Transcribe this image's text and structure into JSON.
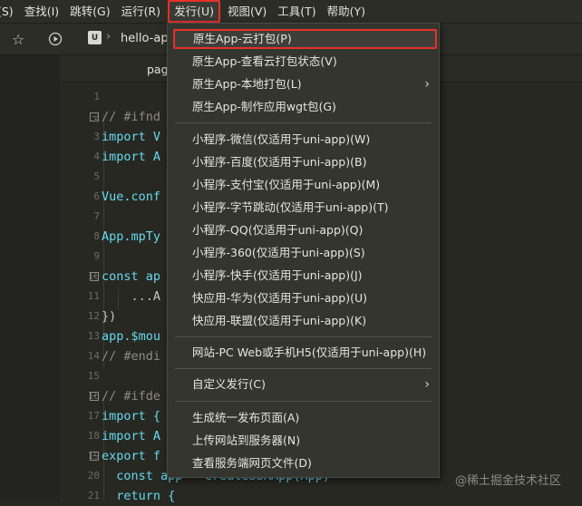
{
  "menubar": {
    "items": [
      "(S)",
      "查找(I)",
      "跳转(G)",
      "运行(R)",
      "发行(U)",
      "视图(V)",
      "工具(T)",
      "帮助(Y)"
    ]
  },
  "toolbar": {
    "breadcrumb": "hello-ap",
    "project_icon_letter": "U"
  },
  "editor": {
    "tab_label": "pages.json",
    "lines": [
      {
        "n": "1",
        "text": ""
      },
      {
        "n": "2",
        "text": "// #ifnd"
      },
      {
        "n": "3",
        "text": "import V"
      },
      {
        "n": "4",
        "text": "import A"
      },
      {
        "n": "5",
        "text": ""
      },
      {
        "n": "6",
        "text": "Vue.conf"
      },
      {
        "n": "7",
        "text": ""
      },
      {
        "n": "8",
        "text": "App.mpTy"
      },
      {
        "n": "9",
        "text": ""
      },
      {
        "n": "10",
        "text": "const ap"
      },
      {
        "n": "11",
        "text": "    ...A"
      },
      {
        "n": "12",
        "text": "})"
      },
      {
        "n": "13",
        "text": "app.$mou"
      },
      {
        "n": "14",
        "text": "// #endi"
      },
      {
        "n": "15",
        "text": ""
      },
      {
        "n": "16",
        "text": "// #ifde"
      },
      {
        "n": "17",
        "text": "import {"
      },
      {
        "n": "18",
        "text": "import A"
      },
      {
        "n": "19",
        "text": "export f"
      },
      {
        "n": "20",
        "text": "  const app = createSSRApp(App)"
      },
      {
        "n": "21",
        "text": "  return {"
      }
    ]
  },
  "dropdown": {
    "items": [
      "原生App-云打包(P)",
      "原生App-查看云打包状态(V)",
      "原生App-本地打包(L)",
      "原生App-制作应用wgt包(G)",
      "小程序-微信(仅适用于uni-app)(W)",
      "小程序-百度(仅适用于uni-app)(B)",
      "小程序-支付宝(仅适用于uni-app)(M)",
      "小程序-字节跳动(仅适用于uni-app)(T)",
      "小程序-QQ(仅适用于uni-app)(Q)",
      "小程序-360(仅适用于uni-app)(S)",
      "小程序-快手(仅适用于uni-app)(J)",
      "快应用-华为(仅适用于uni-app)(U)",
      "快应用-联盟(仅适用于uni-app)(K)",
      "网站-PC Web或手机H5(仅适用于uni-app)(H)",
      "自定义发行(C)",
      "生成统一发布页面(A)",
      "上传网站到服务器(N)",
      "查看服务端网页文件(D)"
    ]
  },
  "watermark": "@稀土掘金技术社区",
  "colors": {
    "highlight_border": "#e8302a",
    "menu_bg": "#34352f",
    "editor_bg": "#272822"
  }
}
